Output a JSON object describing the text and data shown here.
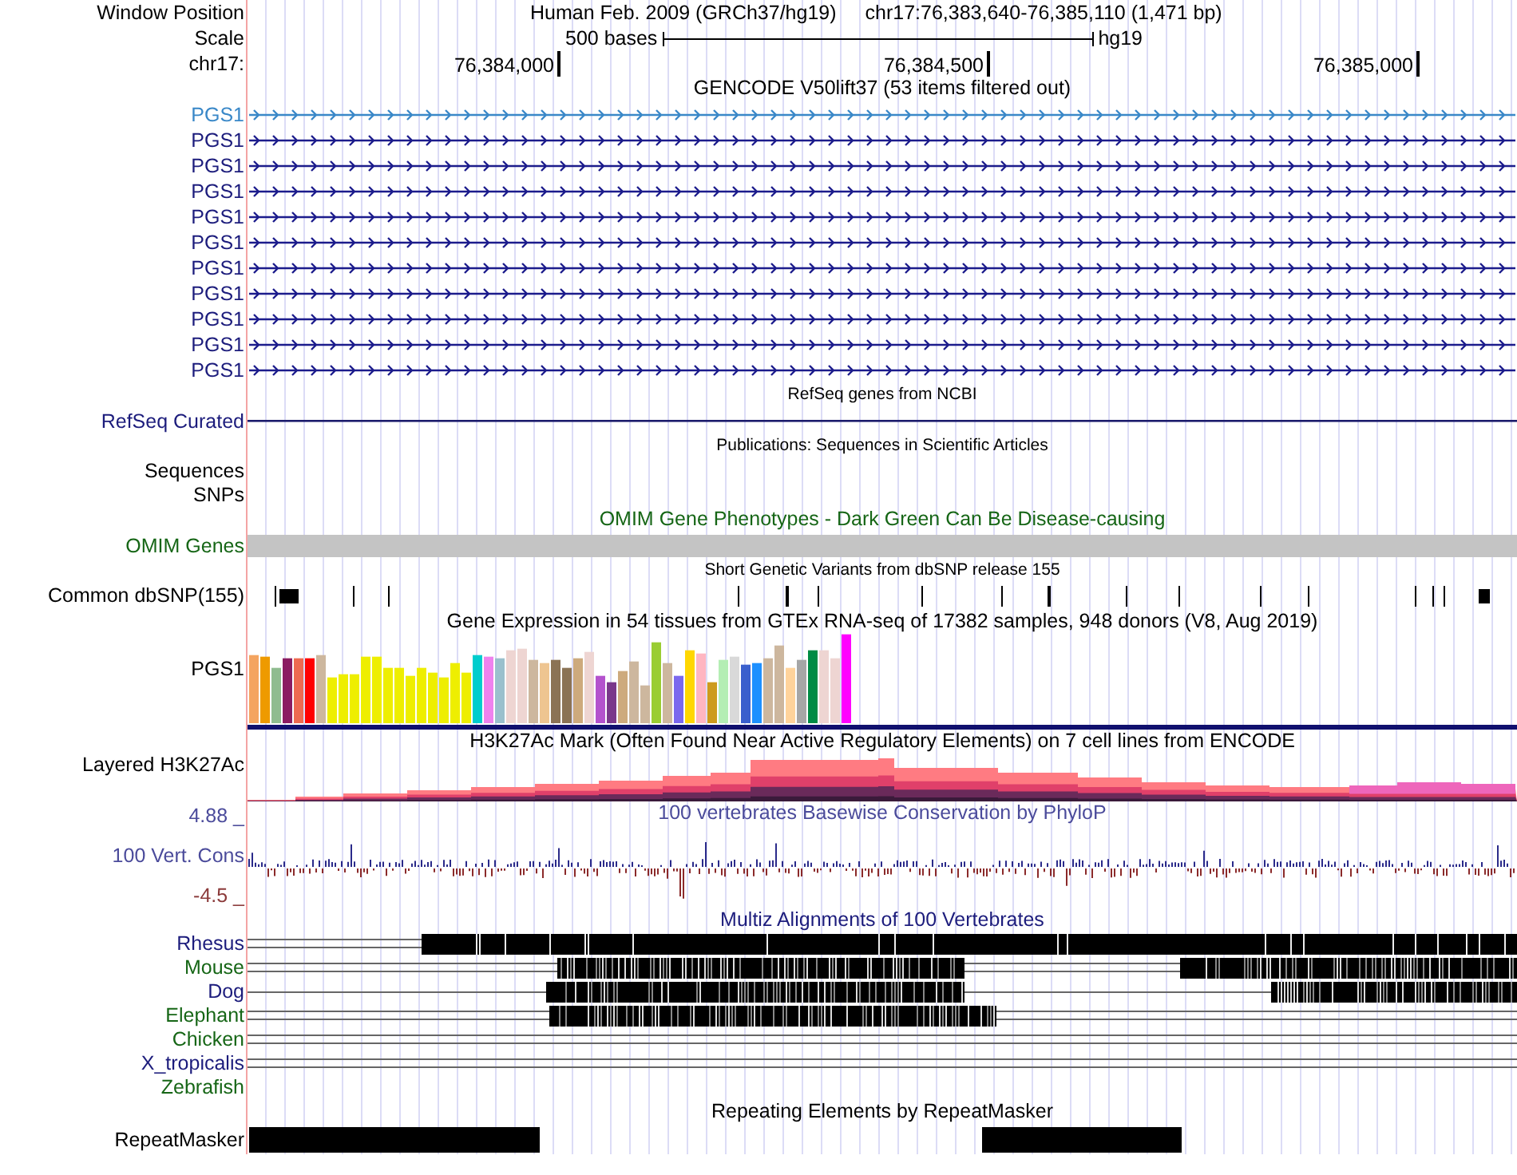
{
  "header": {
    "label": "Window Position",
    "title": "Human Feb. 2009 (GRCh37/hg19)",
    "position": "chr17:76,383,640-76,385,110 (1,471 bp)"
  },
  "scale": {
    "label": "Scale",
    "length": "500 bases",
    "assembly": "hg19"
  },
  "ruler": {
    "label": "chr17:",
    "ticks": [
      "76,384,000",
      "76,384,500",
      "76,385,000"
    ]
  },
  "tracks": [
    {
      "kind": "genes",
      "title": "GENCODE V50lift37 (53 items filtered out)",
      "items": [
        {
          "label": "PGS1",
          "selected": true
        },
        {
          "label": "PGS1",
          "selected": false
        },
        {
          "label": "PGS1",
          "selected": false
        },
        {
          "label": "PGS1",
          "selected": false
        },
        {
          "label": "PGS1",
          "selected": false
        },
        {
          "label": "PGS1",
          "selected": false
        },
        {
          "label": "PGS1",
          "selected": false
        },
        {
          "label": "PGS1",
          "selected": false
        },
        {
          "label": "PGS1",
          "selected": false
        },
        {
          "label": "PGS1",
          "selected": false
        },
        {
          "label": "PGS1",
          "selected": false
        }
      ]
    },
    {
      "kind": "line",
      "title": "RefSeq genes from NCBI",
      "label": "RefSeq Curated"
    },
    {
      "kind": "text",
      "title": "Publications: Sequences in Scientific Articles",
      "labels": [
        "Sequences",
        "SNPs"
      ]
    },
    {
      "kind": "bar",
      "title": "OMIM Gene Phenotypes - Dark Green Can Be Disease-causing",
      "label": "OMIM Genes"
    },
    {
      "kind": "ticks",
      "title": "Short Genetic Variants from dbSNP release 155",
      "label": "Common dbSNP(155)"
    },
    {
      "kind": "expression",
      "title": "Gene Expression in 54 tissues from GTEx RNA-seq of 17382 samples, 948 donors (V8, Aug 2019)",
      "label": "PGS1"
    },
    {
      "kind": "layers",
      "title": "H3K27Ac Mark (Often Found Near Active Regulatory Elements) on 7 cell lines from ENCODE",
      "label": "Layered H3K27Ac"
    },
    {
      "kind": "wiggle",
      "title": "100 vertebrates Basewise Conservation by PhyloP",
      "label": "100 Vert. Cons",
      "max": "4.88 _",
      "min": "-4.5 _"
    },
    {
      "kind": "alignment",
      "title": "Multiz Alignments of 100 Vertebrates",
      "species": [
        {
          "label": "Rhesus",
          "color": "#1c1c7c"
        },
        {
          "label": "Mouse",
          "color": "#166616"
        },
        {
          "label": "Dog",
          "color": "#1c1c7c"
        },
        {
          "label": "Elephant",
          "color": "#166616"
        },
        {
          "label": "Chicken",
          "color": "#166616"
        },
        {
          "label": "X_tropicalis",
          "color": "#1c1c7c"
        },
        {
          "label": "Zebrafish",
          "color": "#166616"
        }
      ]
    },
    {
      "kind": "blocks",
      "title": "Repeating Elements by RepeatMasker",
      "label": "RepeatMasker"
    }
  ]
}
